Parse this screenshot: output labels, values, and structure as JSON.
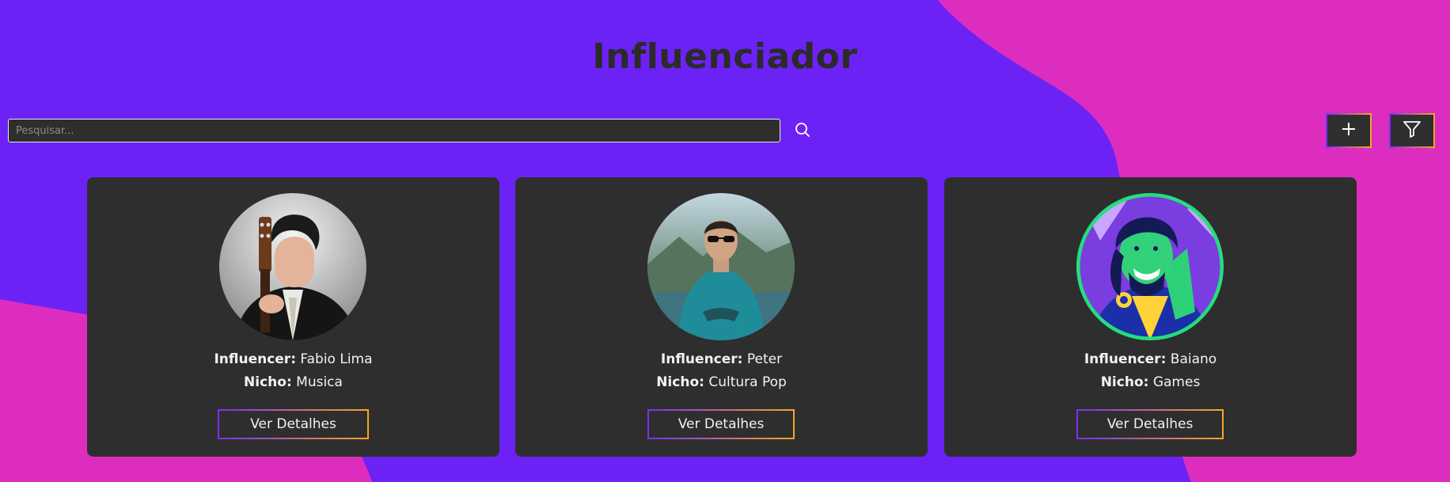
{
  "page": {
    "title": "Influenciador"
  },
  "search": {
    "placeholder": "Pesquisar...",
    "value": ""
  },
  "toolbar": {
    "add_icon": "plus-icon",
    "filter_icon": "filter-icon"
  },
  "colors": {
    "background_purple": "#6c22f5",
    "background_pink": "#dc2dbf",
    "card": "#2e2e2e",
    "button_gradient_start": "#7b2ff7",
    "button_gradient_end": "#f5a623",
    "avatar_ring": "#22e07a"
  },
  "labels": {
    "influencer": "Influencer:",
    "niche": "Nicho:"
  },
  "cards": [
    {
      "name": "Fabio Lima",
      "niche": "Musica",
      "button": "Ver Detalhes",
      "avatar_icon": "avatar-guitar-player"
    },
    {
      "name": "Peter",
      "niche": "Cultura Pop",
      "button": "Ver Detalhes",
      "avatar_icon": "avatar-man-sunglasses"
    },
    {
      "name": "Baiano",
      "niche": "Games",
      "button": "Ver Detalhes",
      "avatar_icon": "avatar-cartoon-sorcerer"
    }
  ]
}
